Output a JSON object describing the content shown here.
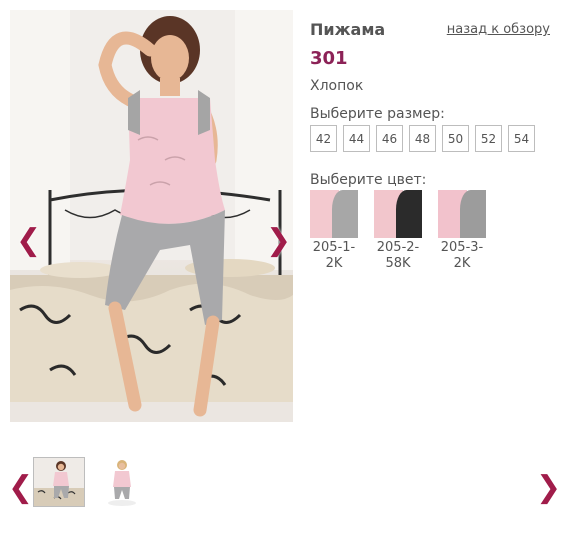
{
  "product": {
    "title": "Пижама",
    "back_link": "назад к обзору",
    "article": "301",
    "material": "Хлопок"
  },
  "sizes": {
    "label": "Выберите размер:",
    "options": [
      "42",
      "44",
      "46",
      "48",
      "50",
      "52",
      "54"
    ]
  },
  "colors": {
    "label": "Выберите цвет:",
    "options": [
      {
        "code": "205-1-2K",
        "top_color": "#f3c9cf",
        "bottom_color": "#a7a7a7"
      },
      {
        "code": "205-2-58K",
        "top_color": "#f2c6cc",
        "bottom_color": "#2b2b2b"
      },
      {
        "code": "205-3-2K",
        "top_color": "#f2c2cc",
        "bottom_color": "#9c9c9c"
      }
    ]
  },
  "navigation": {
    "prev_glyph": "❮",
    "next_glyph": "❯"
  },
  "theme": {
    "accent": "#8c2257",
    "arrow": "#a01c4a",
    "text": "#555555"
  }
}
